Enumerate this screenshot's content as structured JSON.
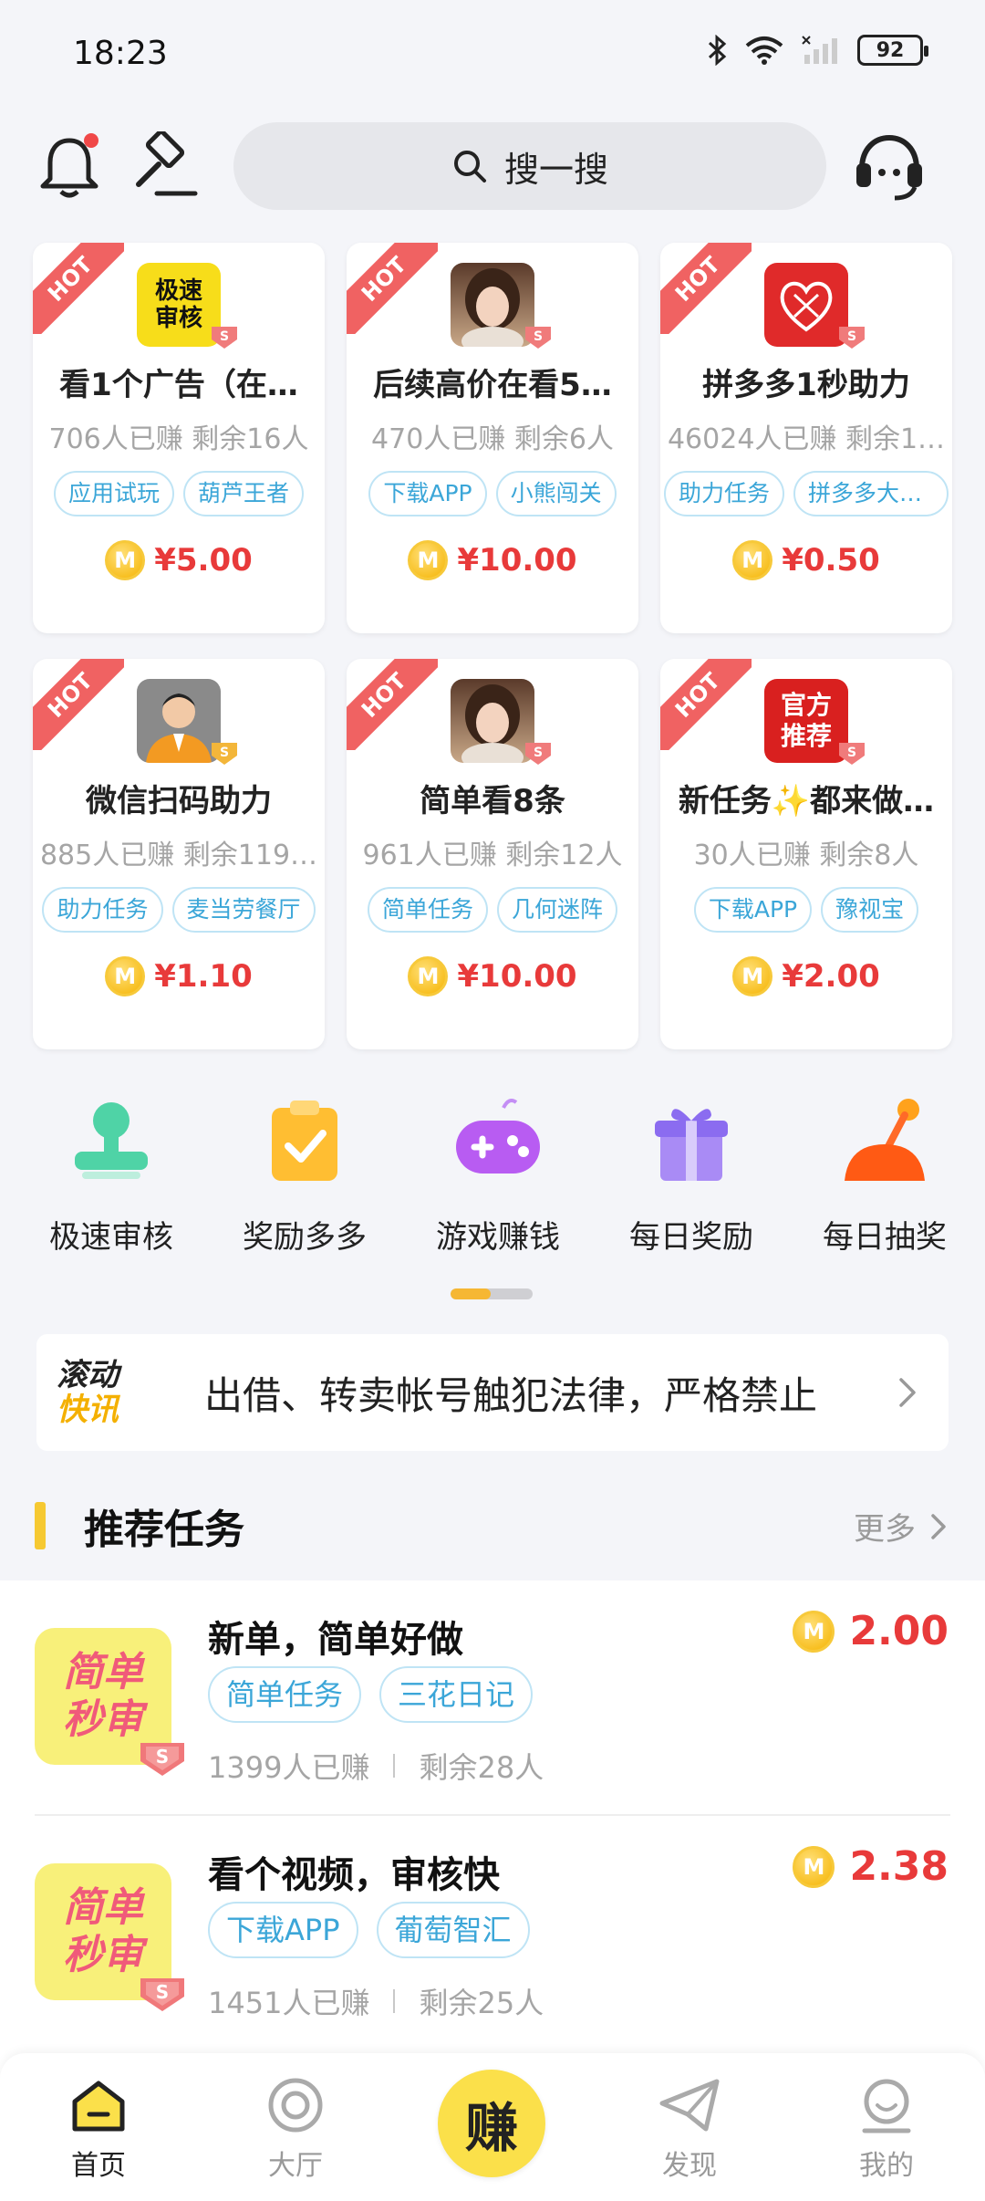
{
  "status_bar": {
    "time": "18:23",
    "battery": "92"
  },
  "search": {
    "placeholder": "搜一搜"
  },
  "hot_cards": [
    {
      "title": "看1个广告（在…",
      "stats": "706人已赚   剩余16人",
      "tags": [
        "应用试玩",
        "葫芦王者"
      ],
      "price": "¥5.00",
      "icon": "fast-review-icon"
    },
    {
      "title": "后续高价在看5…",
      "stats": "470人已赚   剩余6人",
      "tags": [
        "下载APP",
        "小熊闯关"
      ],
      "price": "¥10.00",
      "icon": "girl-avatar-icon"
    },
    {
      "title": "拼多多1秒助力",
      "stats": "46024人已赚   剩余1…",
      "tags": [
        "助力任务",
        "拼多多大转…"
      ],
      "price": "¥0.50",
      "icon": "pinduoduo-icon"
    },
    {
      "title": "微信扫码助力",
      "stats": "885人已赚   剩余119…",
      "tags": [
        "助力任务",
        "麦当劳餐厅"
      ],
      "price": "¥1.10",
      "icon": "businessman-avatar-icon"
    },
    {
      "title": "简单看8条",
      "stats": "961人已赚   剩余12人",
      "tags": [
        "简单任务",
        "几何迷阵"
      ],
      "price": "¥10.00",
      "icon": "girl-avatar-icon"
    },
    {
      "title": "新任务✨都来做…",
      "stats": "30人已赚   剩余8人",
      "tags": [
        "下载APP",
        "豫视宝"
      ],
      "price": "¥2.00",
      "icon": "official-recommend-icon"
    }
  ],
  "hot_badge": "HOT",
  "icon_texts": {
    "fast_review_l1": "极速",
    "fast_review_l2": "审核",
    "official_l1": "官方",
    "official_l2": "推荐",
    "coin": "M",
    "s_badge": "S"
  },
  "categories": [
    {
      "label": "极速审核",
      "icon": "stamp-icon"
    },
    {
      "label": "奖励多多",
      "icon": "clipboard-check-icon"
    },
    {
      "label": "游戏赚钱",
      "icon": "gamepad-icon"
    },
    {
      "label": "每日奖励",
      "icon": "gift-icon"
    },
    {
      "label": "每日抽奖",
      "icon": "joystick-icon"
    }
  ],
  "news": {
    "logo_line1": "滚动",
    "logo_line2": "快讯",
    "text": "出借、转卖帐号触犯法律，严格禁止"
  },
  "recommended": {
    "title": "推荐任务",
    "more": "更多"
  },
  "tasks": [
    {
      "thumb_l1": "简单",
      "thumb_l2": "秒审",
      "title": "新单，简单好做",
      "tags": [
        "简单任务",
        "三花日记"
      ],
      "earned": "1399人已赚",
      "remaining": "剩余28人",
      "price": "2.00"
    },
    {
      "thumb_l1": "简单",
      "thumb_l2": "秒审",
      "title": "看个视频，审核快",
      "tags": [
        "下载APP",
        "葡萄智汇"
      ],
      "earned": "1451人已赚",
      "remaining": "剩余25人",
      "price": "2.38"
    }
  ],
  "bottom_nav": {
    "home": "首页",
    "hall": "大厅",
    "earn": "赚",
    "discover": "发现",
    "mine": "我的"
  },
  "colors": {
    "accent_yellow": "#fbe04a",
    "price_red": "#e83a3a",
    "tag_blue": "#3ba6d8",
    "hot_red": "#f06262"
  }
}
